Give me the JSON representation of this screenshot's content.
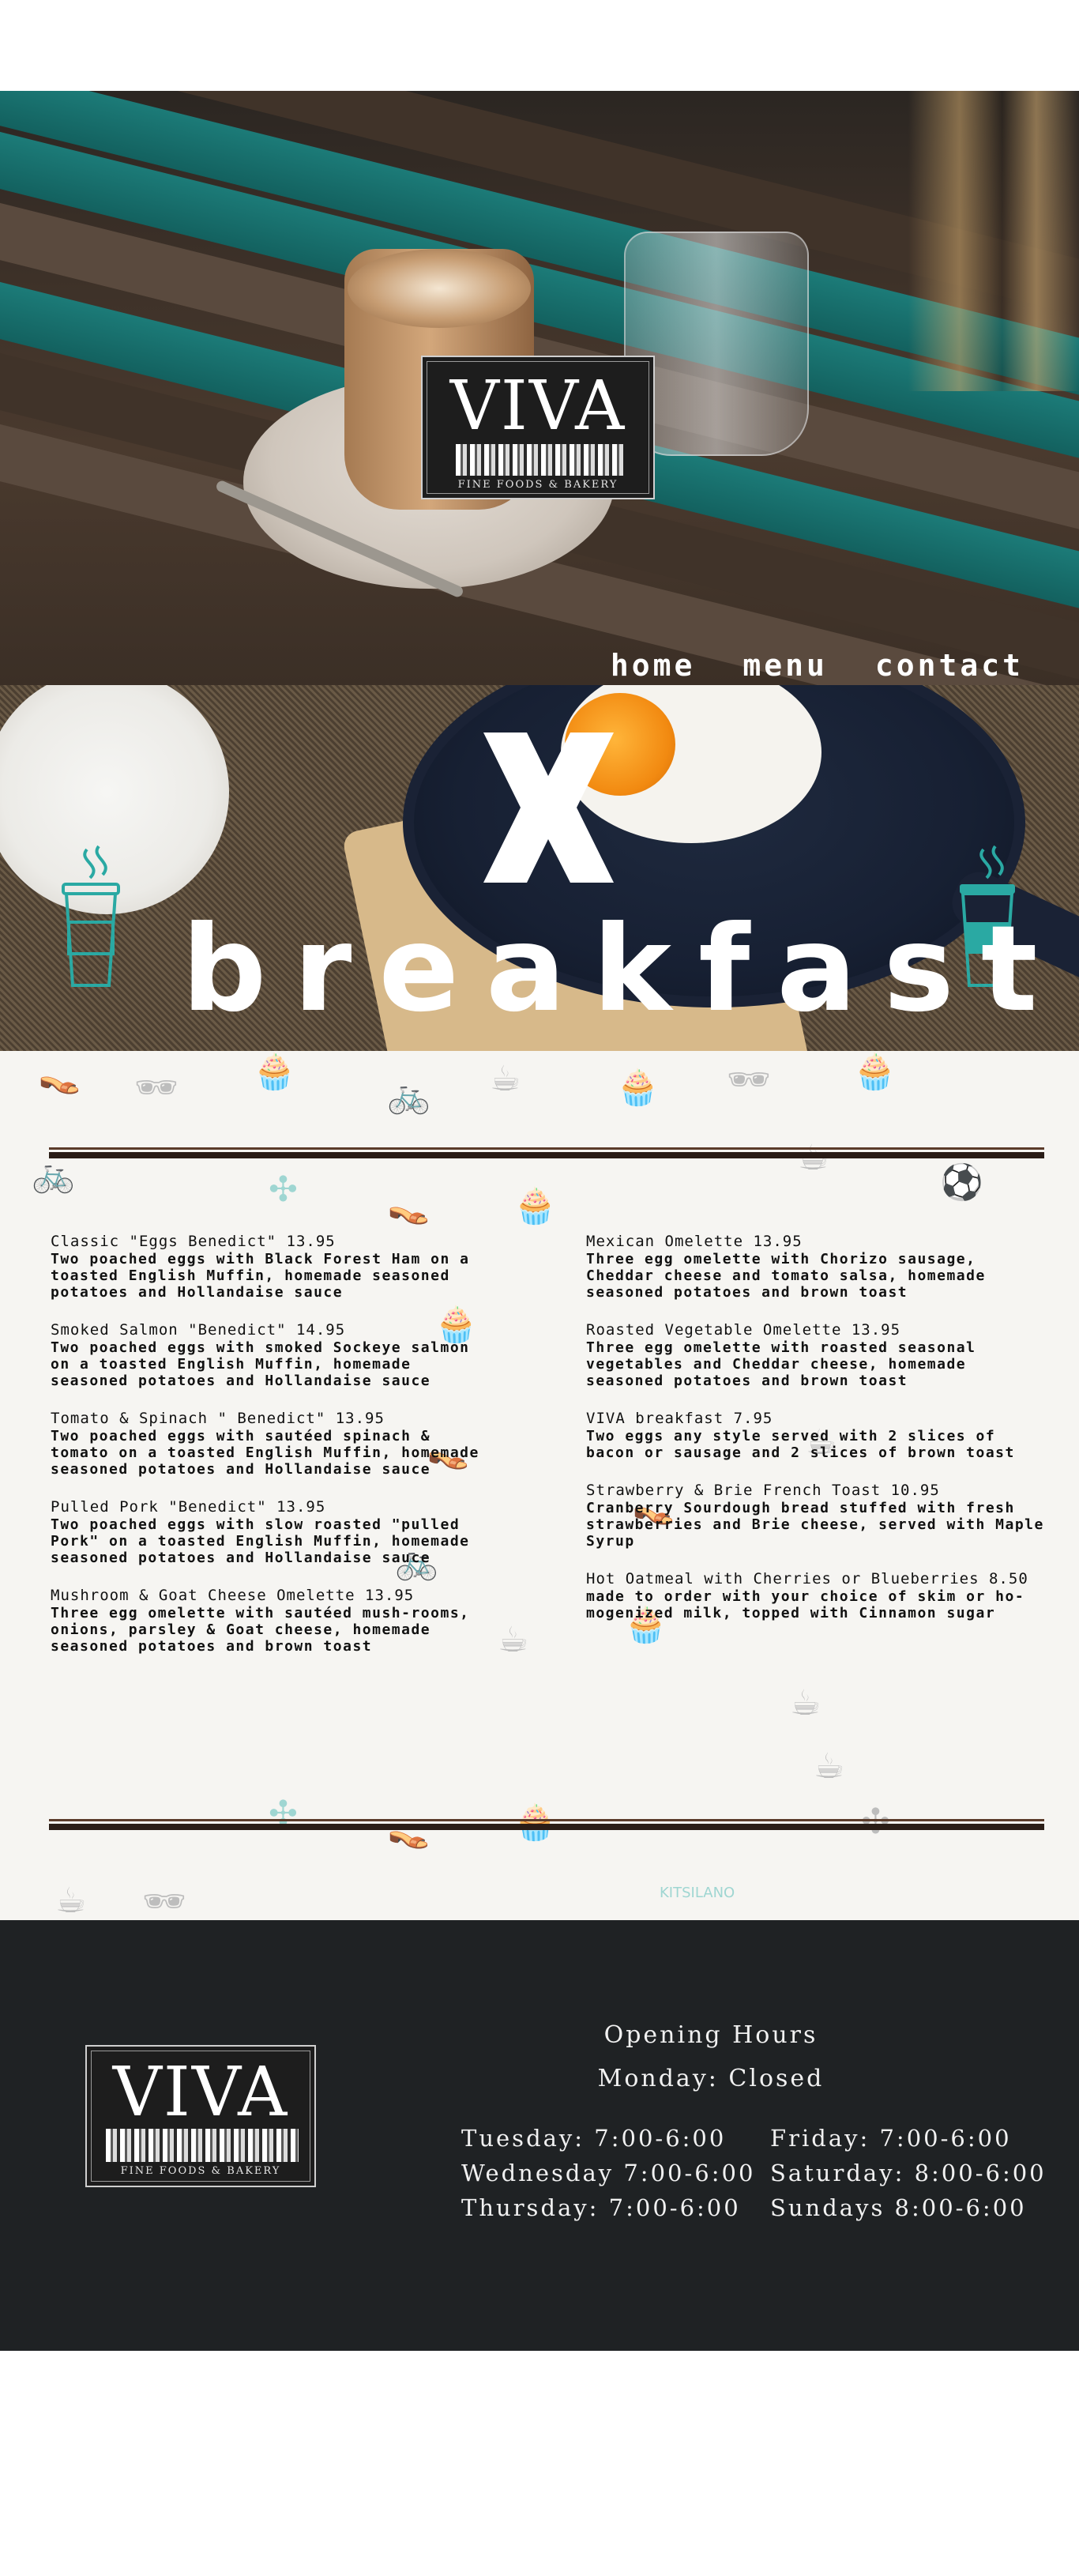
{
  "hero": {
    "logo": {
      "title": "VIVA",
      "subtitle": "FINE FOODS & BAKERY"
    }
  },
  "nav": {
    "items": [
      {
        "label": "home"
      },
      {
        "label": "menu"
      },
      {
        "label": "contact"
      }
    ]
  },
  "banner": {
    "title": "breakfast"
  },
  "menu": {
    "left": [
      {
        "title": "Classic \"Eggs Benedict\" 13.95",
        "desc": "Two poached eggs with Black Forest Ham on a toasted English Muffin, homemade seasoned potatoes and Hollandaise sauce"
      },
      {
        "title": "Smoked Salmon \"Benedict\" 14.95",
        "desc": "Two poached eggs with smoked Sockeye salmon on a toasted English Muffin, homemade seasoned potatoes and Hollandaise sauce"
      },
      {
        "title": "Tomato & Spinach \" Benedict\" 13.95",
        "desc": "Two poached eggs with sautéed spinach & tomato on a toasted English Muffin, homemade seasoned potatoes and Hollandaise sauce"
      },
      {
        "title": "Pulled Pork \"Benedict\" 13.95",
        "desc": "Two poached eggs with slow roasted \"pulled Pork\" on a toasted English Muffin, homemade seasoned potatoes and Hollandaise sauce"
      },
      {
        "title": "Mushroom & Goat Cheese Omelette 13.95",
        "desc": "Three egg omelette with sautéed mush-rooms, onions, parsley & Goat cheese, homemade seasoned potatoes and brown toast"
      }
    ],
    "right": [
      {
        "title": "Mexican Omelette 13.95",
        "desc": "Three egg omelette with Chorizo sausage, Cheddar cheese and tomato salsa, homemade seasoned potatoes and brown toast"
      },
      {
        "title": "Roasted Vegetable Omelette 13.95",
        "desc": "Three egg omelette with roasted seasonal vegetables and Cheddar cheese, homemade seasoned potatoes and brown toast"
      },
      {
        "title": "VIVA breakfast 7.95",
        "desc": "Two eggs any style served with 2 slices of bacon or sausage and 2 slices of brown toast"
      },
      {
        "title": "Strawberry & Brie French Toast 10.95",
        "desc": "Cranberry Sourdough bread stuffed with fresh strawberries and Brie cheese, served with Maple Syrup"
      },
      {
        "title": "Hot Oatmeal with Cherries or Blueberries 8.50",
        "desc": "made to order with your choice of skim or ho-mogenized milk, topped with Cinnamon sugar"
      }
    ],
    "watermark": "KITSILANO"
  },
  "footer": {
    "logo": {
      "title": "VIVA",
      "subtitle": "FINE FOODS & BAKERY"
    },
    "hours_title": "Opening Hours",
    "closed": "Monday: Closed",
    "left": [
      "Tuesday: 7:00-6:00",
      "Wednesday 7:00-6:00",
      "Thursday: 7:00-6:00"
    ],
    "right": [
      "Friday: 7:00-6:00",
      "Saturday: 8:00-6:00",
      "Sundays 8:00-6:00"
    ]
  },
  "colors": {
    "footer_bg": "#1f2224",
    "teal_accent": "#2aa9a3",
    "rule": "#2a1d17"
  }
}
